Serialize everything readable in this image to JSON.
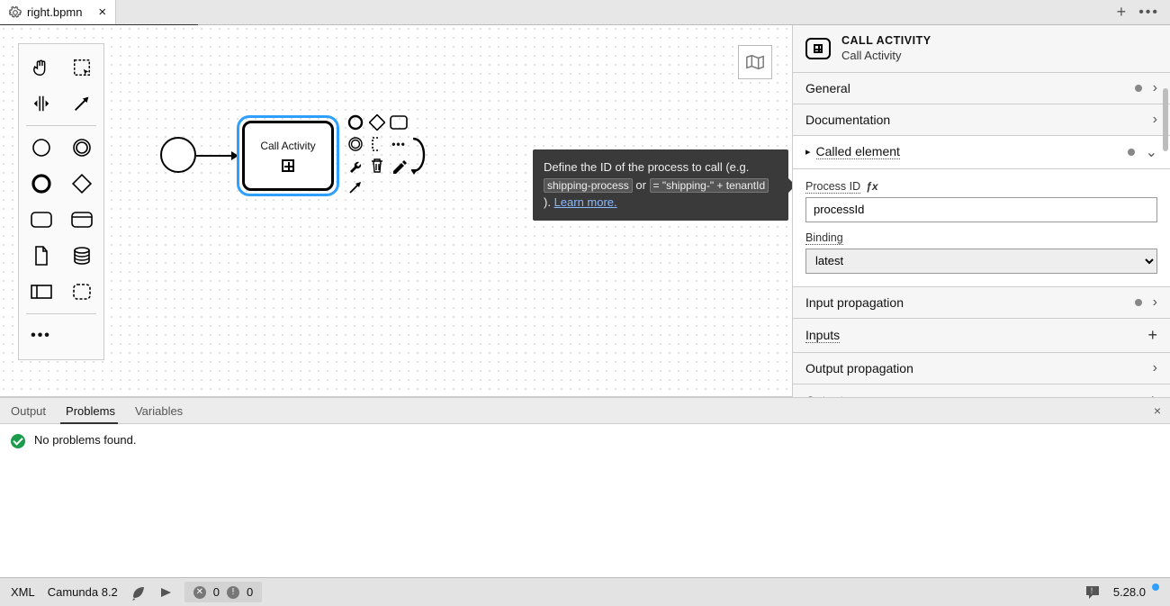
{
  "tab": {
    "filename": "right.bpmn"
  },
  "diagram": {
    "call_activity_label": "Call Activity"
  },
  "tooltip": {
    "text_a": "Define the ID of the process to call (e.g. ",
    "code_a": "shipping-process",
    "text_b": " or ",
    "code_b": "= \"shipping-\" + tenantId",
    "text_c": " ). ",
    "link": "Learn more."
  },
  "props": {
    "header_type": "CALL ACTIVITY",
    "header_name": "Call Activity",
    "sections": {
      "general": "General",
      "documentation": "Documentation",
      "called_element": "Called element",
      "process_id_label": "Process ID",
      "process_id_value": "processId",
      "binding_label": "Binding",
      "binding_value": "latest",
      "input_propagation": "Input propagation",
      "inputs": "Inputs",
      "output_propagation": "Output propagation",
      "outputs": "Outputs"
    }
  },
  "bottom_tabs": {
    "output": "Output",
    "problems": "Problems",
    "variables": "Variables"
  },
  "problems_msg": "No problems found.",
  "status": {
    "xml": "XML",
    "engine": "Camunda 8.2",
    "err_count": "0",
    "warn_count": "0",
    "version": "5.28.0"
  }
}
